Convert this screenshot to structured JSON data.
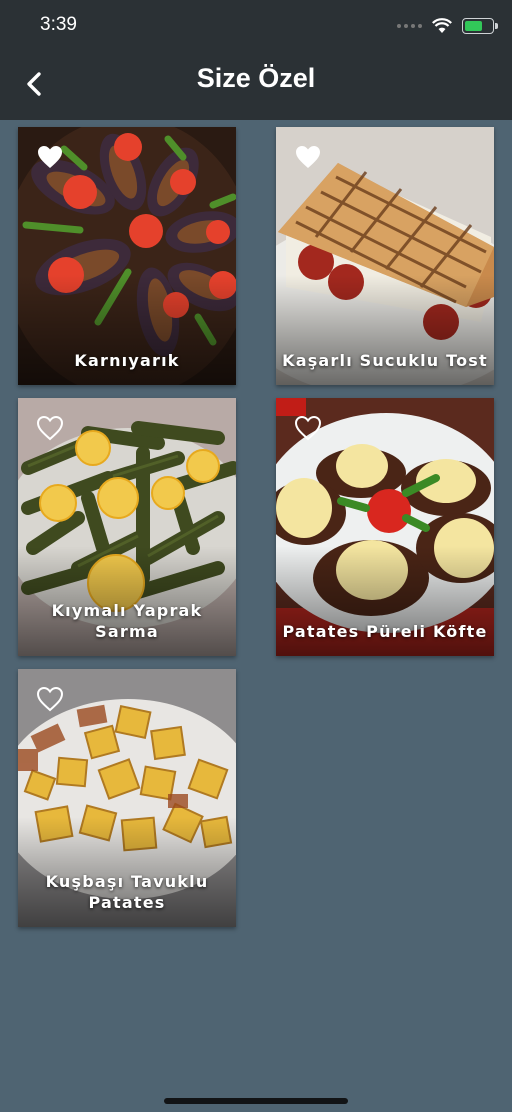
{
  "status_bar": {
    "time": "3:39"
  },
  "nav": {
    "title": "Size Özel",
    "back_icon": "chevron-left-icon"
  },
  "recipes": [
    {
      "title": "Karnıyarık",
      "favorite": true
    },
    {
      "title": "Kaşarlı Sucuklu Tost",
      "favorite": true
    },
    {
      "title": "Kıymalı Yaprak Sarma",
      "favorite": false
    },
    {
      "title": "Patates Püreli Köfte",
      "favorite": false
    },
    {
      "title": "Kuşbaşı Tavuklu Patates",
      "favorite": false
    }
  ],
  "colors": {
    "background": "#4f6472",
    "app_bar": "#2b3135",
    "text": "#ffffff",
    "battery": "#32c759"
  }
}
